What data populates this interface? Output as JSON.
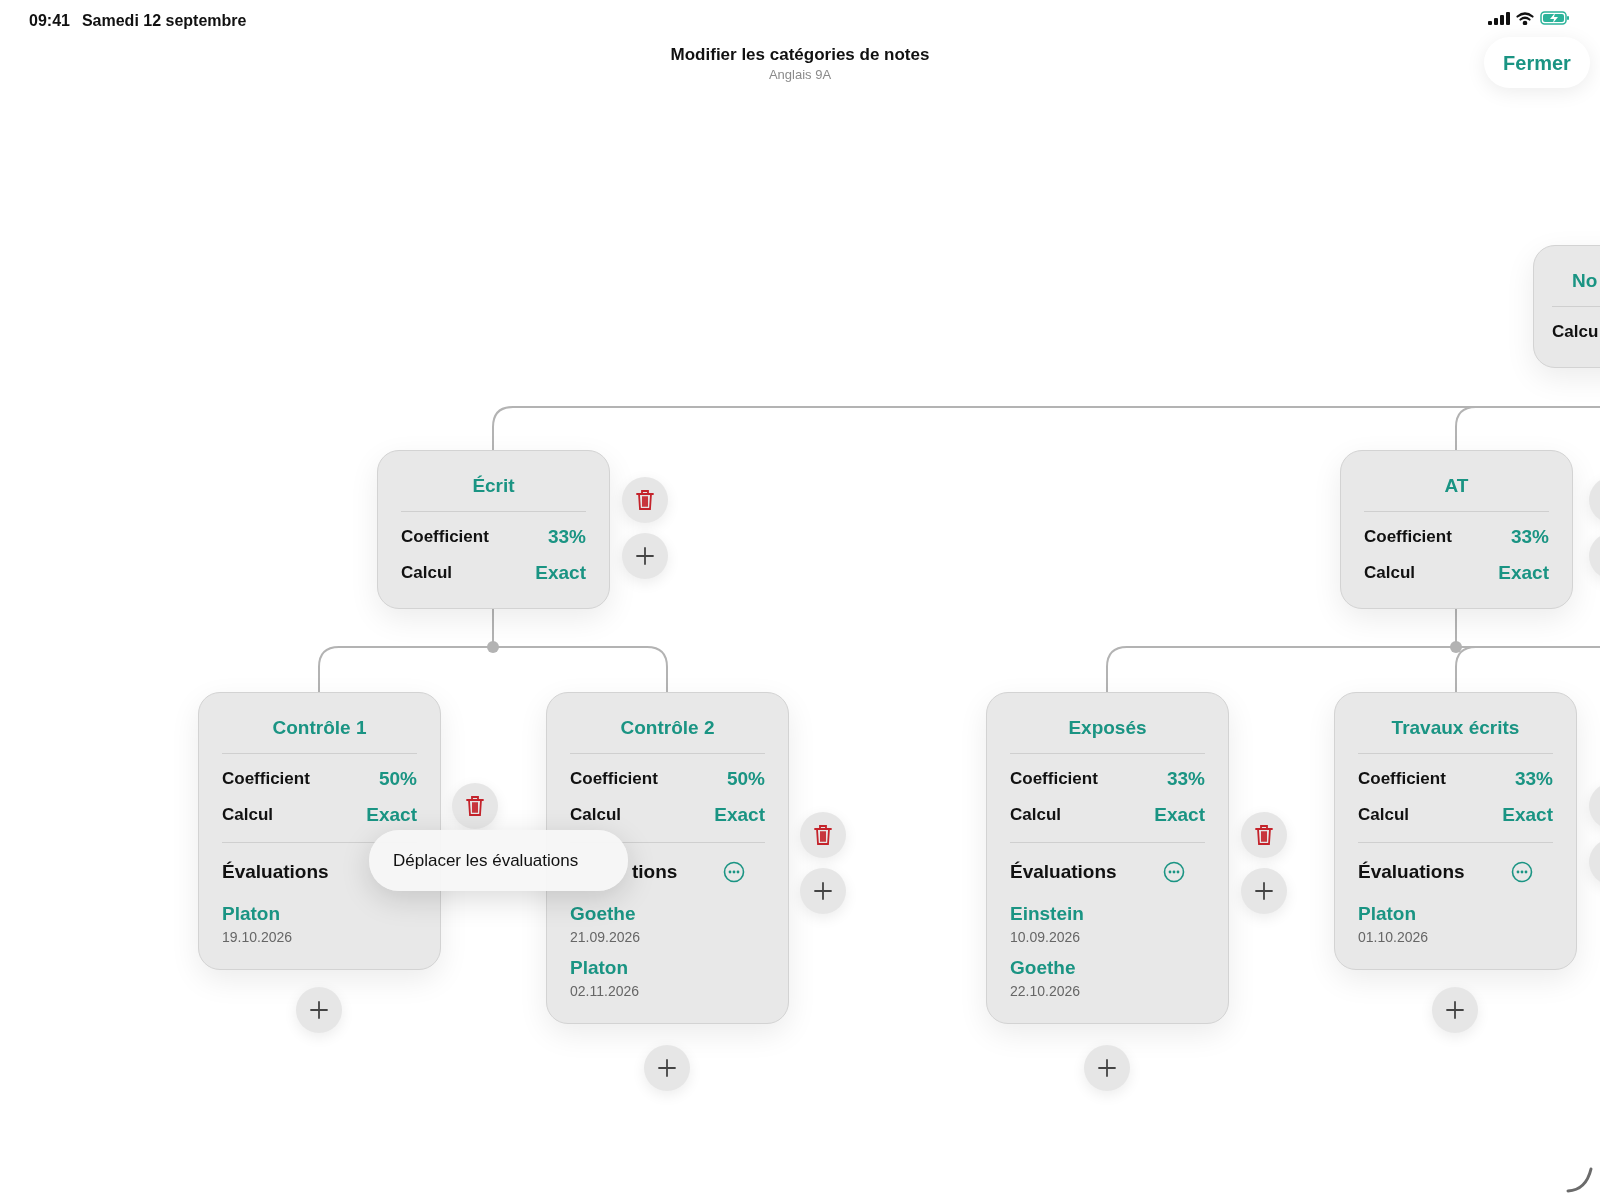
{
  "status_bar": {
    "time": "09:41",
    "date": "Samedi 12 septembre"
  },
  "header": {
    "title": "Modifier les catégories de notes",
    "subtitle": "Anglais 9A",
    "close_button": "Fermer"
  },
  "categories": [
    {
      "title": "No",
      "rows": [
        {
          "label": "Calcu"
        }
      ]
    },
    {
      "title": "Écrit",
      "rows": [
        {
          "label": "Coefficient",
          "value": "33%"
        },
        {
          "label": "Calcul",
          "value": "Exact"
        }
      ]
    },
    {
      "title": "AT",
      "rows": [
        {
          "label": "Coefficient",
          "value": "33%"
        },
        {
          "label": "Calcul",
          "value": "Exact"
        }
      ]
    },
    {
      "title": "Contrôle 1",
      "rows": [
        {
          "label": "Coefficient",
          "value": "50%"
        },
        {
          "label": "Calcul",
          "value": "Exact"
        }
      ],
      "evaluations": {
        "label": "Évaluations",
        "items": [
          {
            "name": "Platon",
            "date": "19.10.2026"
          }
        ]
      },
      "menu": {
        "items": [
          "Déplacer les évaluations"
        ]
      }
    },
    {
      "title": "Contrôle 2",
      "rows": [
        {
          "label": "Coefficient",
          "value": "50%"
        },
        {
          "label": "Calcul",
          "value": "Exact"
        }
      ],
      "evaluations": {
        "label": "tions",
        "partly_hidden": true,
        "items": [
          {
            "name": "Goethe",
            "date": "21.09.2026"
          },
          {
            "name": "Platon",
            "date": "02.11.2026"
          }
        ]
      }
    },
    {
      "title": "Exposés",
      "rows": [
        {
          "label": "Coefficient",
          "value": "33%"
        },
        {
          "label": "Calcul",
          "value": "Exact"
        }
      ],
      "evaluations": {
        "label": "Évaluations",
        "items": [
          {
            "name": "Einstein",
            "date": "10.09.2026"
          },
          {
            "name": "Goethe",
            "date": "22.10.2026"
          }
        ]
      }
    },
    {
      "title": "Travaux écrits",
      "rows": [
        {
          "label": "Coefficient",
          "value": "33%"
        },
        {
          "label": "Calcul",
          "value": "Exact"
        }
      ],
      "evaluations": {
        "label": "Évaluations",
        "items": [
          {
            "name": "Platon",
            "date": "01.10.2026"
          }
        ]
      }
    }
  ]
}
